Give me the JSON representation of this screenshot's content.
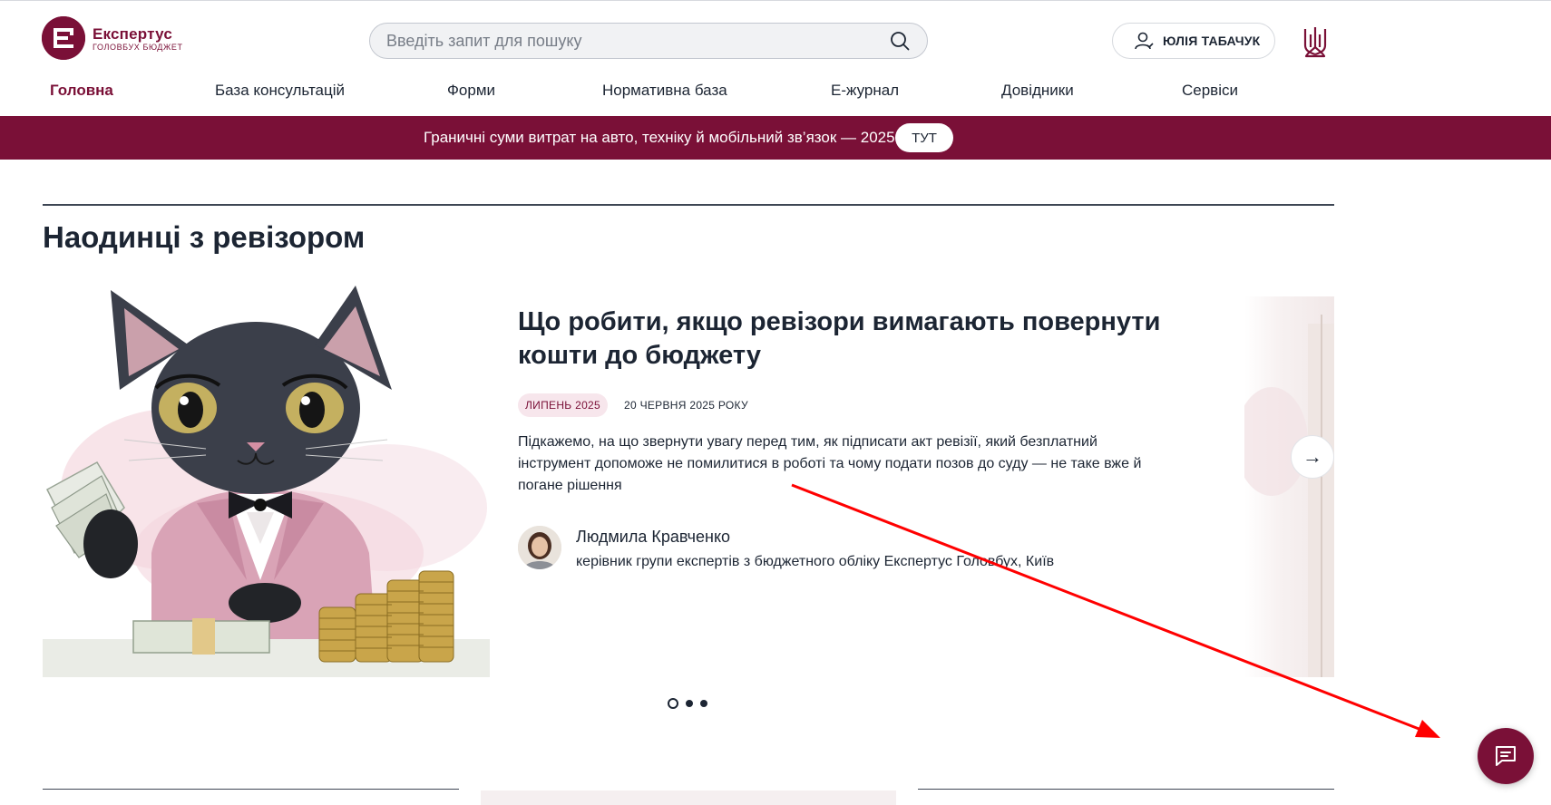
{
  "header": {
    "logo_title": "Експертус",
    "logo_subtitle": "ГОЛОВБУХ БЮДЖЕТ",
    "search_placeholder": "Введіть запит для пошуку",
    "user_name": "ЮЛІЯ ТАБАЧУК"
  },
  "nav": {
    "items": [
      {
        "label": "Головна",
        "active": true
      },
      {
        "label": "База консультацій",
        "active": false
      },
      {
        "label": "Форми",
        "active": false
      },
      {
        "label": "Нормативна база",
        "active": false
      },
      {
        "label": "Е-журнал",
        "active": false
      },
      {
        "label": "Довідники",
        "active": false
      },
      {
        "label": "Сервіси",
        "active": false
      }
    ]
  },
  "banner": {
    "text": "Граничні суми витрат на авто, техніку й мобільний зв’язок — 2025",
    "button_label": "ТУТ"
  },
  "section": {
    "title": "Наодинці з ревізором"
  },
  "article": {
    "title": "Що робити, якщо ревізори вимагають повернути кошти до бюджету",
    "tag": "ЛИПЕНЬ 2025",
    "date": "20 ЧЕРВНЯ 2025 РОКУ",
    "excerpt": "Підкажемо, на що звернути увагу перед тим, як підписати акт ревізії, який безплатний інструмент допоможе не помилитися в роботі та чому подати позов до суду — не таке вже й погане рішення",
    "author_name": "Людмила Кравченко",
    "author_role": "керівник групи експертів з бюджетного обліку Експертус Головбух, Київ"
  },
  "carousel": {
    "next_arrow": "→",
    "slides_count": 3,
    "active_index": 0
  },
  "colors": {
    "brand": "#7a1037",
    "text": "#1c2533",
    "annotation_arrow": "#ff0000"
  },
  "icons": [
    "search-icon",
    "user-icon",
    "trident-icon",
    "arrow-right-icon",
    "chat-icon"
  ]
}
